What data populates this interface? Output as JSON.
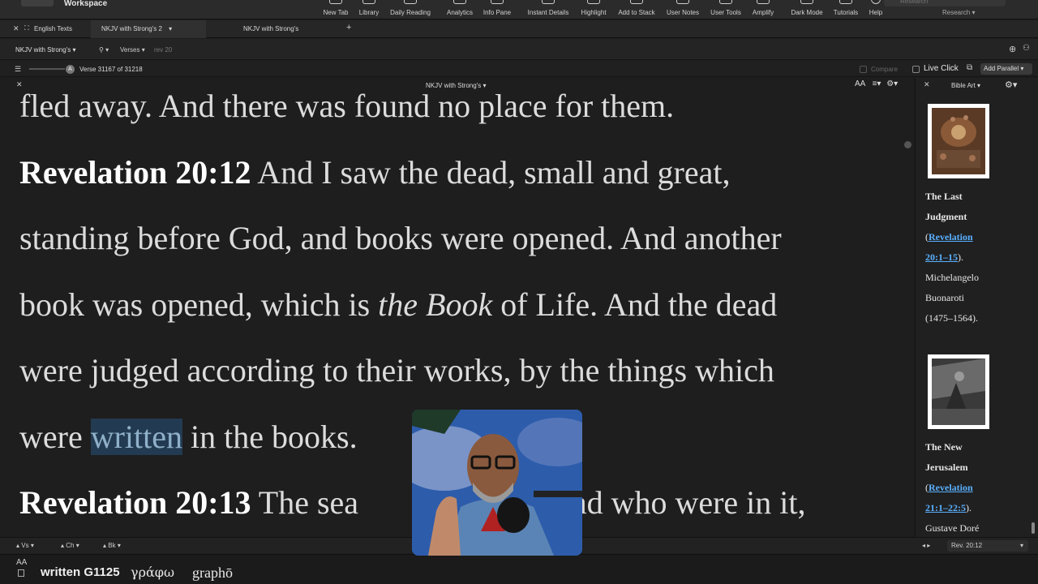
{
  "toolbar": {
    "app_title": "Workspace",
    "items": [
      {
        "label": "New Tab",
        "icon": "new-tab-icon"
      },
      {
        "label": "Library",
        "icon": "library-icon"
      },
      {
        "label": "Daily Reading",
        "icon": "daily-reading-icon"
      },
      {
        "label": "Analytics",
        "icon": "analytics-icon"
      },
      {
        "label": "Info Pane",
        "icon": "info-pane-icon"
      },
      {
        "label": "Instant Details",
        "icon": "instant-details-icon"
      },
      {
        "label": "Highlight",
        "icon": "highlight-icon"
      },
      {
        "label": "Add to Stack",
        "icon": "stack-icon"
      },
      {
        "label": "User Notes",
        "icon": "notes-icon"
      },
      {
        "label": "User Tools",
        "icon": "tools-icon"
      },
      {
        "label": "Amplify",
        "icon": "amplify-icon"
      },
      {
        "label": "Dark Mode",
        "icon": "dark-mode-icon"
      },
      {
        "label": "Tutorials",
        "icon": "tutorials-icon"
      },
      {
        "label": "Help",
        "icon": "help-icon"
      }
    ],
    "research_label": "Research",
    "research_placeholder": "Research"
  },
  "tabs": {
    "group_label": "English Texts",
    "items": [
      {
        "label": "NKJV with Strong's 2",
        "active": true
      },
      {
        "label": "NKJV with Strong's",
        "active": false
      }
    ]
  },
  "resource_bar": {
    "module": "NKJV with Strong's",
    "search_mode": "Verses",
    "search_value": "rev 20"
  },
  "verse_bar": {
    "slider_label": "A",
    "verse_position": "Verse 31167 of 31218",
    "compare_label": "Compare",
    "live_click_label": "Live Click",
    "add_parallel_label": "Add Parallel"
  },
  "main_pane": {
    "title": "NKJV with Strong's",
    "font_size_label": "AA",
    "lines": {
      "l0": "fled away. And there was found no place for them.",
      "l1_ref": "Revelation 20:12",
      "l1": " And I saw the dead, small and great,",
      "l2": "standing before God, and books were opened. And another",
      "l3_a": "book was opened, which is ",
      "l3_i": "the Book",
      "l3_b": " of Life. And the dead",
      "l4": "were judged according to their works, by the things which",
      "l5_a": "were ",
      "l5_hl": "written",
      "l5_b": " in the books.",
      "l6_ref": "Revelation 20:13",
      "l6_a": " The sea ",
      "l6_b": "dead who were in it,"
    }
  },
  "art_pane": {
    "title": "Bible Art",
    "artworks": [
      {
        "title_a": "The Last",
        "title_b": "Judgment",
        "link_a": "Revelation",
        "link_b": "20:1–15",
        "after_link": ").",
        "artist_a": "Michelangelo",
        "artist_b": "Buonaroti",
        "dates": "(1475–1564)."
      },
      {
        "title_a": "The New",
        "title_b": "Jerusalem",
        "link_a": "Revelation",
        "link_b": "21:1–22:5",
        "after_link": ").",
        "artist_a": "Gustave Doré"
      }
    ]
  },
  "bottom_nav": {
    "verse_label": "Vs",
    "chapter_label": "Ch",
    "book_label": "Bk",
    "current_ref": "Rev. 20:12"
  },
  "status_bar": {
    "font_label": "AA",
    "word": "written",
    "strongs": "G1125",
    "greek": "γράφω",
    "transliteration": "graphō"
  },
  "colors": {
    "background": "#1e1e1e",
    "text": "#dcdcdc",
    "highlight": "#233b52",
    "link": "#5ab0ff"
  }
}
